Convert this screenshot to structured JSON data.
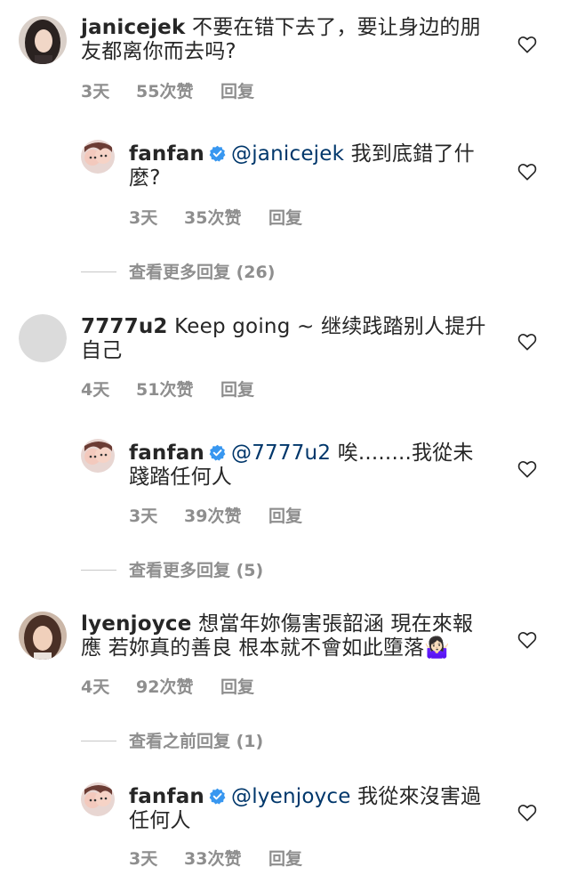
{
  "comments": [
    {
      "username": "janicejek",
      "text": "不要在错下去了，要让身边的朋友都离你而去吗?",
      "time": "3天",
      "likes": "55次赞",
      "reply": "回复",
      "reply_thread": {
        "username": "fanfan",
        "mention": "@janicejek",
        "text": "我到底錯了什麼?",
        "time": "3天",
        "likes": "35次赞",
        "reply": "回复"
      },
      "view_more": "查看更多回复 (26)"
    },
    {
      "username": "7777u2",
      "text": "Keep going ~ 继续践踏别人提升自己",
      "time": "4天",
      "likes": "51次赞",
      "reply": "回复",
      "reply_thread": {
        "username": "fanfan",
        "mention": "@7777u2",
        "text": "唉........我從未踐踏任何人",
        "time": "3天",
        "likes": "39次赞",
        "reply": "回复"
      },
      "view_more": "查看更多回复 (5)"
    },
    {
      "username": "lyenjoyce",
      "text": "想當年妳傷害張韶涵 現在來報應 若妳真的善良 根本就不會如此墮落🤷🏻‍♀️",
      "time": "4天",
      "likes": "92次赞",
      "reply": "回复",
      "view_previous": "查看之前回复 (1)",
      "reply_thread": {
        "username": "fanfan",
        "mention": "@lyenjoyce",
        "text": "我從來沒害過任何人",
        "time": "3天",
        "likes": "33次赞",
        "reply": "回复"
      }
    }
  ],
  "colors": {
    "text": "#262626",
    "meta": "#8e8e8e",
    "mention": "#00376b",
    "verified": "#3897f0"
  }
}
